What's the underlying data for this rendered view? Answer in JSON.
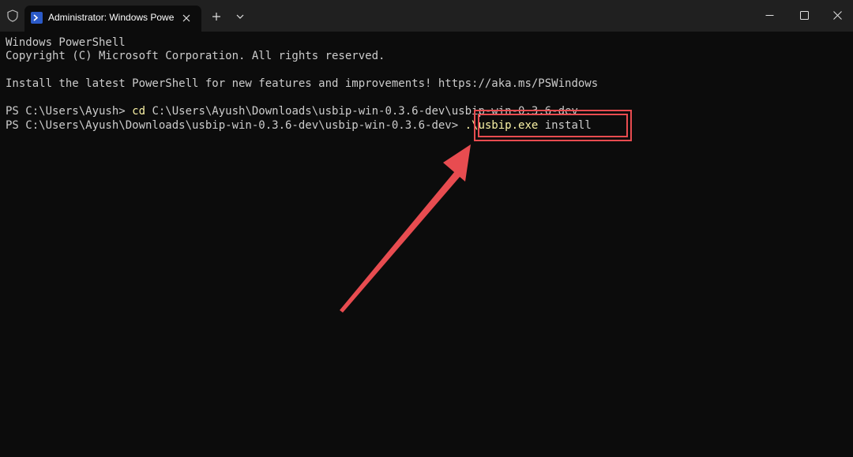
{
  "tab": {
    "title": "Administrator: Windows PowerShell",
    "icon": "powershell-icon"
  },
  "window_controls": {
    "minimize_icon": "minimize-icon",
    "maximize_icon": "maximize-icon",
    "close_icon": "close-icon"
  },
  "terminal": {
    "lines": [
      "Windows PowerShell",
      "Copyright (C) Microsoft Corporation. All rights reserved.",
      "",
      "Install the latest PowerShell for new features and improvements! https://aka.ms/PSWindows",
      ""
    ],
    "prompt1": "PS C:\\Users\\Ayush> ",
    "command1_keyword": "cd",
    "command1_arg": " C:\\Users\\Ayush\\Downloads\\usbip-win-0.3.6-dev\\usbip-win-0.3.6-dev",
    "prompt2": "PS C:\\Users\\Ayush\\Downloads\\usbip-win-0.3.6-dev\\usbip-win-0.3.6-dev> ",
    "command2_keyword": ".\\usbip.exe",
    "command2_arg": " install"
  },
  "colors": {
    "background": "#0c0c0c",
    "titlebar": "#202020",
    "text": "#cccccc",
    "command": "#f9f1a5",
    "annotation": "#e84c50"
  }
}
